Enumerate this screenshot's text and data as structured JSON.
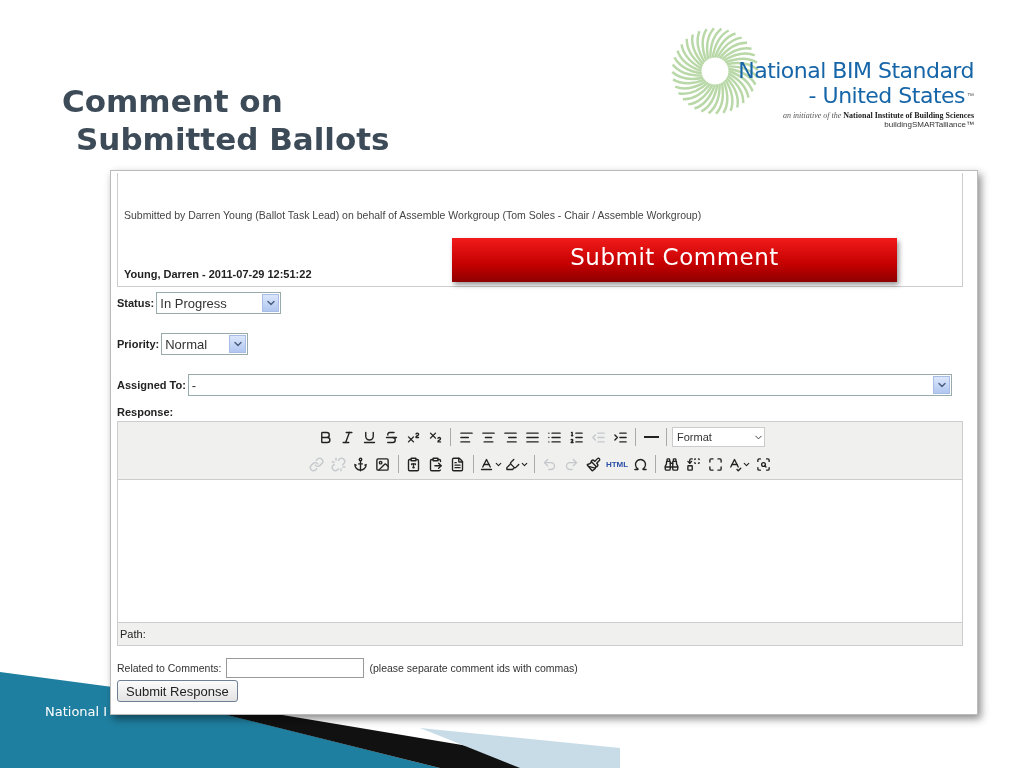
{
  "slide": {
    "title_lines": [
      "Comment on",
      "Submitted Ballots"
    ],
    "footer": "National I"
  },
  "logo": {
    "line_1": "National BIM Standard",
    "line_2": "- United States",
    "trademark": "™",
    "tagline": "*an initiative of the* **National Institute of Building Sciences**",
    "alliance": "buildingSMARTalliance™"
  },
  "comment": {
    "text": "Submitted by Darren Young (Ballot Task Lead) on behalf of Assemble Workgroup (Tom Soles - Chair / Assemble Workgroup)",
    "author_line": "Young, Darren - 2011-07-29 12:51:22"
  },
  "callout": {
    "label": "Submit Comment"
  },
  "form": {
    "status": {
      "label": "Status:",
      "value": "In Progress"
    },
    "priority": {
      "label": "Priority:",
      "value": "Normal"
    },
    "assigned": {
      "label": "Assigned To:",
      "value": "-"
    },
    "response": {
      "label": "Response:"
    }
  },
  "toolbar": [
    [
      {
        "kind": "button",
        "disabled": false
      },
      {
        "kind": "button",
        "disabled": false
      },
      {
        "kind": "button",
        "disabled": false
      },
      {
        "kind": "button",
        "disabled": false
      },
      {
        "kind": "button",
        "disabled": false
      },
      {
        "kind": "button",
        "disabled": false
      },
      {
        "kind": "separator"
      },
      {
        "kind": "button",
        "disabled": false
      },
      {
        "kind": "button",
        "disabled": false
      },
      {
        "kind": "button",
        "disabled": false
      },
      {
        "kind": "button",
        "disabled": false
      },
      {
        "kind": "button",
        "disabled": false
      },
      {
        "kind": "button",
        "disabled": false
      },
      {
        "kind": "button",
        "disabled": true
      },
      {
        "kind": "button",
        "disabled": false
      },
      {
        "kind": "separator"
      },
      {
        "kind": "button",
        "disabled": false
      },
      {
        "kind": "separator"
      },
      {
        "kind": "select",
        "value": "Format"
      }
    ],
    [
      {
        "kind": "button",
        "disabled": true
      },
      {
        "kind": "button",
        "disabled": true
      },
      {
        "kind": "button",
        "disabled": false
      },
      {
        "kind": "button",
        "disabled": false
      },
      {
        "kind": "separator"
      },
      {
        "kind": "button",
        "disabled": false
      },
      {
        "kind": "button",
        "disabled": false
      },
      {
        "kind": "button",
        "disabled": false
      },
      {
        "kind": "separator"
      },
      {
        "kind": "split",
        "disabled": false
      },
      {
        "kind": "split",
        "disabled": false
      },
      {
        "kind": "separator"
      },
      {
        "kind": "button",
        "disabled": true
      },
      {
        "kind": "button",
        "disabled": true
      },
      {
        "kind": "button",
        "disabled": false
      },
      {
        "kind": "text",
        "label": "HTML",
        "disabled": false
      },
      {
        "kind": "button",
        "disabled": false
      },
      {
        "kind": "separator"
      },
      {
        "kind": "button",
        "disabled": false
      },
      {
        "kind": "button",
        "disabled": false
      },
      {
        "kind": "button",
        "disabled": false
      },
      {
        "kind": "split",
        "disabled": false
      },
      {
        "kind": "button",
        "disabled": false
      }
    ]
  ],
  "editor": {
    "path_label": "Path:"
  },
  "related": {
    "label": "Related to Comments:",
    "hint": "(please separate comment ids with commas)"
  },
  "submit": {
    "label": "Submit Response"
  }
}
